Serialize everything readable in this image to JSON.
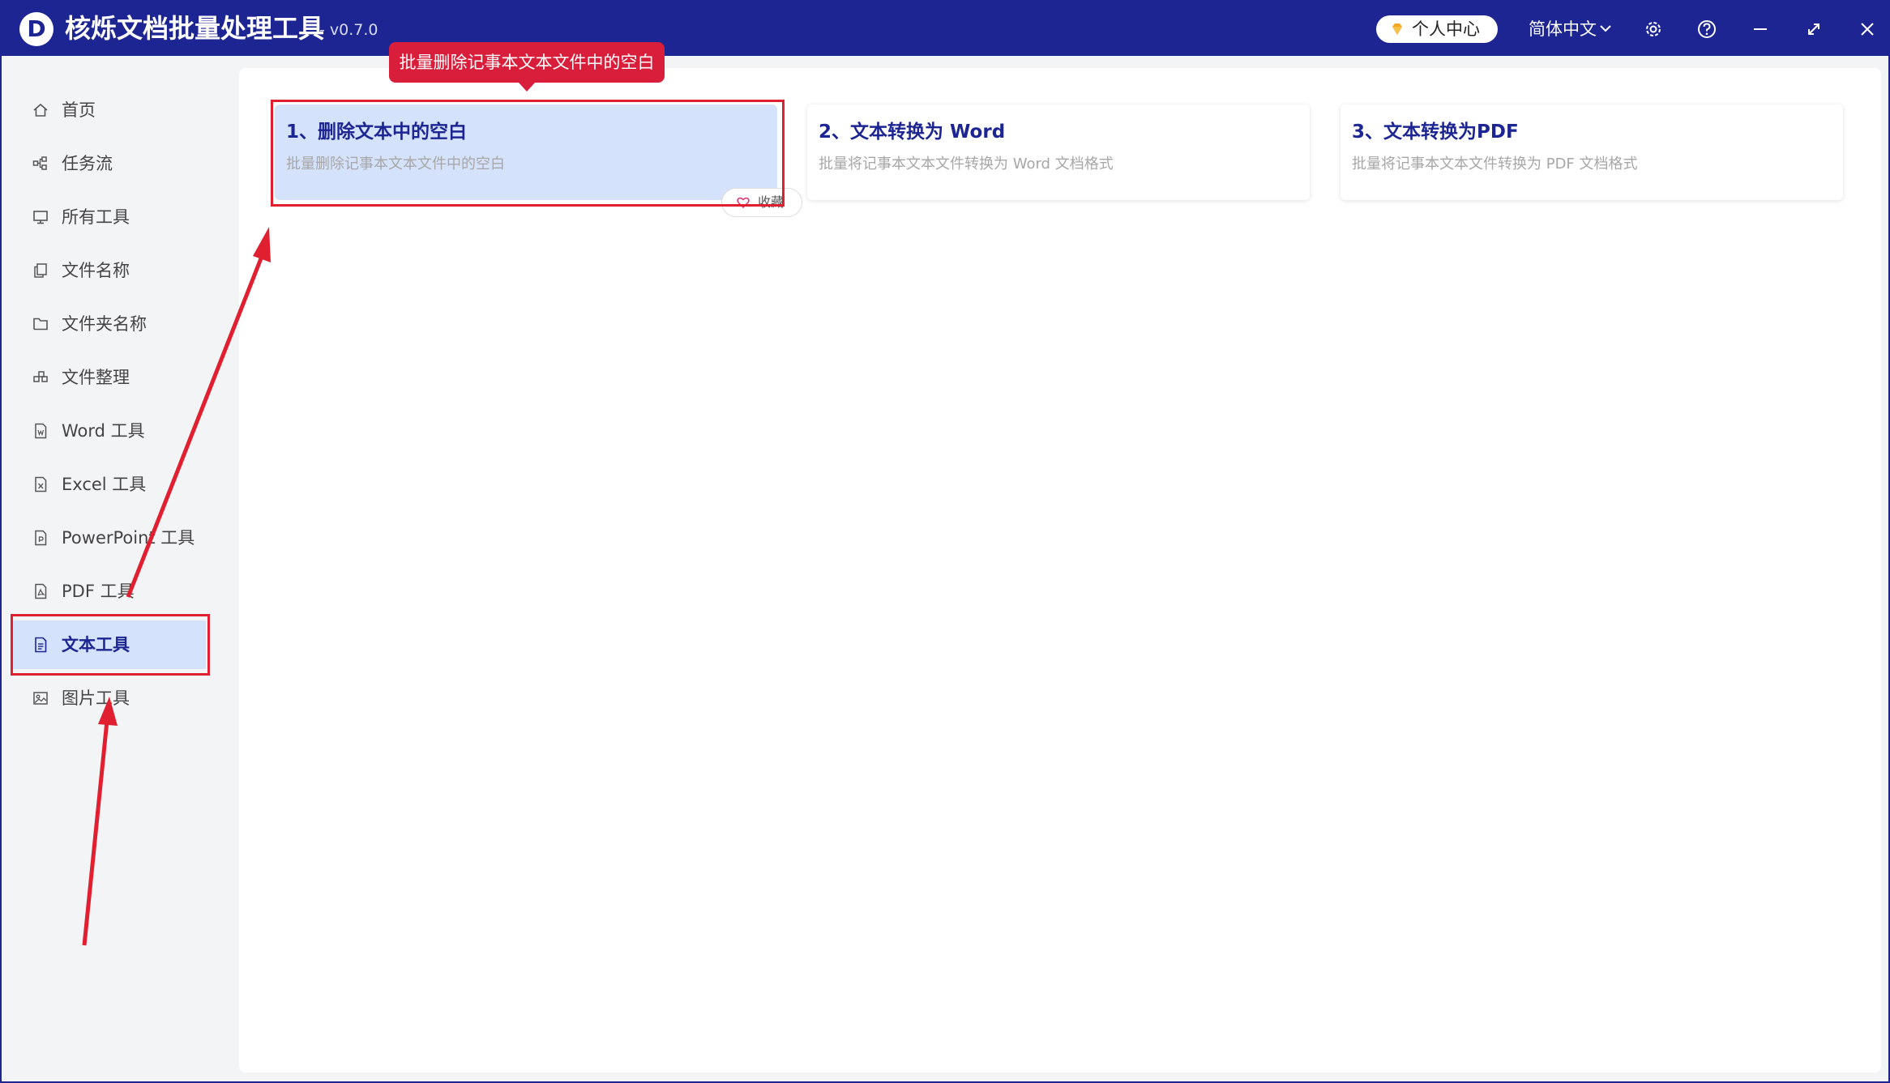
{
  "titlebar": {
    "logo_letter": "D",
    "app_name": "核烁文档批量处理工具",
    "version": "- v0.7.0",
    "user_center_label": "个人中心",
    "language": "简体中文",
    "icons": [
      "gem-icon",
      "chevron-down-icon",
      "gear-icon",
      "help-icon",
      "minimize-icon",
      "maximize-icon",
      "close-icon"
    ]
  },
  "sidebar": {
    "items": [
      {
        "label": "首页",
        "icon": "home-icon"
      },
      {
        "label": "任务流",
        "icon": "workflow-icon"
      },
      {
        "label": "所有工具",
        "icon": "monitor-icon"
      },
      {
        "label": "文件名称",
        "icon": "file-copy-icon"
      },
      {
        "label": "文件夹名称",
        "icon": "folder-icon"
      },
      {
        "label": "文件整理",
        "icon": "organize-icon"
      },
      {
        "label": "Word 工具",
        "icon": "word-file-icon"
      },
      {
        "label": "Excel 工具",
        "icon": "excel-file-icon"
      },
      {
        "label": "PowerPoint 工具",
        "icon": "ppt-file-icon"
      },
      {
        "label": "PDF 工具",
        "icon": "pdf-file-icon"
      },
      {
        "label": "文本工具",
        "icon": "text-file-icon",
        "active": true
      },
      {
        "label": "图片工具",
        "icon": "image-icon"
      }
    ]
  },
  "tooltip": "批量删除记事本文本文件中的空白",
  "cards": [
    {
      "title": "1、删除文本中的空白",
      "desc": "批量删除记事本文本文件中的空白",
      "selected": true
    },
    {
      "title": "2、文本转换为 Word",
      "desc": "批量将记事本文本文件转换为 Word 文档格式"
    },
    {
      "title": "3、文本转换为PDF",
      "desc": "批量将记事本文本文件转换为 PDF 文档格式"
    }
  ],
  "favorite_label": "收藏",
  "colors": {
    "brand": "#1c2592",
    "selected_bg": "#d4e2fb",
    "annotation_red": "#e02030",
    "tooltip_red": "#d81e3a"
  }
}
